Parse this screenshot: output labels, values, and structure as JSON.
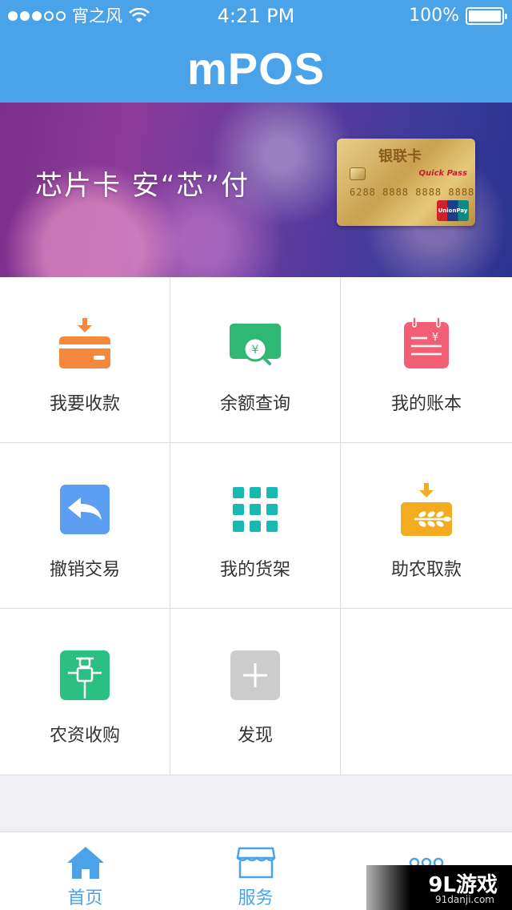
{
  "status_bar": {
    "carrier": "宵之风",
    "time": "4:21 PM",
    "battery": "100%"
  },
  "header": {
    "title": "mPOS"
  },
  "banner": {
    "slogan": "芯片卡  安“芯”付",
    "card": {
      "title": "银联卡",
      "number": "6288 8888 8888 8888",
      "quickpass": "Quick Pass",
      "brand": "UnionPay"
    }
  },
  "grid": {
    "items": [
      {
        "label": "我要收款",
        "icon": "receive-payment-icon",
        "color": "#f4893b"
      },
      {
        "label": "余额查询",
        "icon": "balance-query-icon",
        "color": "#2fb873"
      },
      {
        "label": "我的账本",
        "icon": "ledger-icon",
        "color": "#f25f74"
      },
      {
        "label": "撤销交易",
        "icon": "undo-transaction-icon",
        "color": "#5b9ef2"
      },
      {
        "label": "我的货架",
        "icon": "shelf-grid-icon",
        "color": "#17b9b0"
      },
      {
        "label": "助农取款",
        "icon": "agri-withdraw-icon",
        "color": "#f3ab20"
      },
      {
        "label": "农资收购",
        "icon": "scarecrow-icon",
        "color": "#2bbf82"
      },
      {
        "label": "发现",
        "icon": "plus-icon",
        "color": "#cccccc"
      }
    ]
  },
  "tabbar": {
    "items": [
      {
        "label": "首页",
        "icon": "home-icon"
      },
      {
        "label": "服务",
        "icon": "shop-icon"
      }
    ]
  },
  "watermark": {
    "main": "9L游戏",
    "sub": "91danji.com"
  },
  "colors": {
    "primary": "#4aa3e8",
    "background": "#efeff4"
  }
}
